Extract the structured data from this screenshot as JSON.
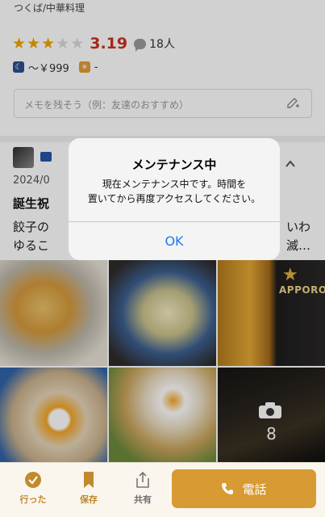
{
  "header": {
    "genre": "つくば/中華料理",
    "rating": {
      "stars_filled": 3,
      "stars_total": 5,
      "score": "3.19",
      "review_count": "18人"
    },
    "price": {
      "dinner": "～￥999",
      "lunch": "-"
    }
  },
  "memo": {
    "placeholder": "メモを残そう（例：友達のおすすめ）"
  },
  "review": {
    "date_visible": "2024/0",
    "title_visible": "誕生祝",
    "text_line1": "餃子の",
    "text_line2": "ゆるこ",
    "text_tail1": "いわ",
    "text_tail2": "滅…"
  },
  "photos": {
    "more_count": "8",
    "sapporo_label": "APPORO"
  },
  "tabbar": {
    "went": "行った",
    "save": "保存",
    "share": "共有",
    "call": "電話"
  },
  "alert": {
    "title": "メンテナンス中",
    "message_line1": "現在メンテナンス中です。時間を",
    "message_line2": "置いてから再度アクセスしてください。",
    "ok": "OK"
  },
  "colors": {
    "accent": "#d89a32",
    "score": "#c8321f",
    "star": "#f0a500",
    "ios_blue": "#1a7cf5"
  }
}
